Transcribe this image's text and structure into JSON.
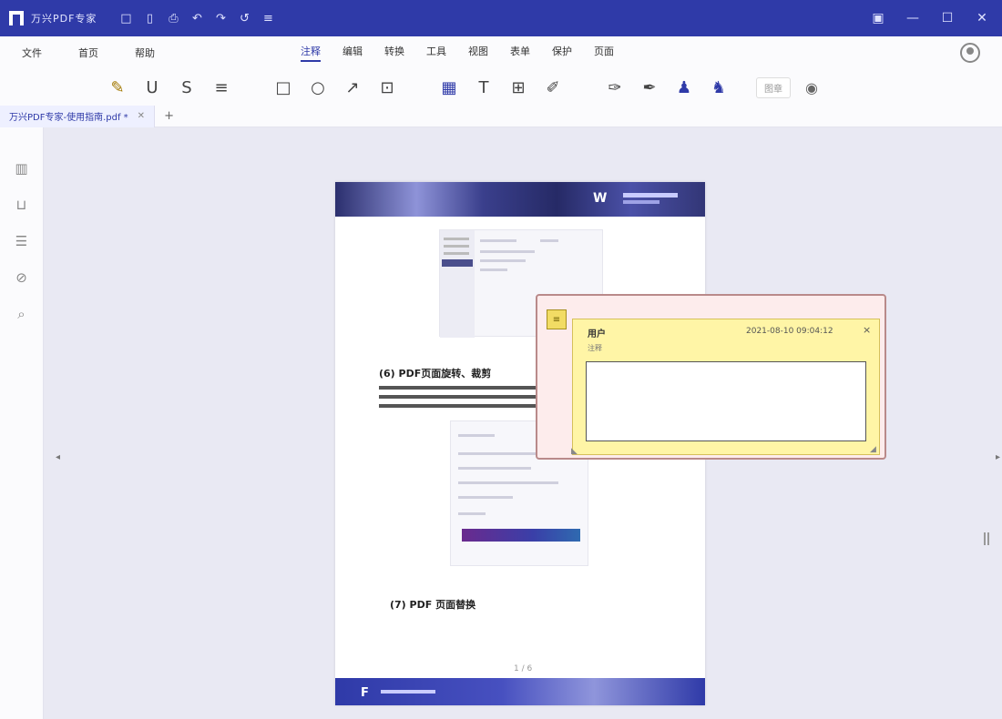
{
  "titlebar": {
    "app_title": "万兴PDF专家",
    "quick_icons": [
      "□",
      "▯",
      "⎙",
      "↶",
      "↷",
      "↺",
      "≡"
    ],
    "window_buttons": [
      "▣",
      "—",
      "☐",
      "✕"
    ]
  },
  "menubar": {
    "left": [
      "文件",
      "首页",
      "帮助"
    ],
    "right": [
      "注释",
      "编辑",
      "转换",
      "工具",
      "视图",
      "表单",
      "保护",
      "页面"
    ],
    "active": "注释"
  },
  "toolbar": {
    "stamp_label": "图章",
    "icons": [
      "highlight-icon",
      "underline-icon",
      "strikethrough-icon",
      "squiggly-icon",
      "rectangle-icon",
      "ellipse-icon",
      "arrow-icon",
      "area-icon",
      "textbox-icon",
      "typewriter-icon",
      "callout-icon",
      "pencil-icon",
      "note-icon",
      "eraser-icon",
      "attachment-icon",
      "stamp-icon",
      "signature-icon",
      "eye-icon"
    ]
  },
  "tab": {
    "label": "万兴PDF专家-使用指南.pdf *",
    "close": "✕",
    "add": "+"
  },
  "rail_icons": [
    "thumbnail-icon",
    "bookmark-icon",
    "annotation-list-icon",
    "attachment-icon",
    "search-icon"
  ],
  "page": {
    "banner_logo": "W",
    "heading_1": "(6) PDF页面旋转、裁剪",
    "heading_2": "(7) PDF 页面替换",
    "page_number": "1 / 6",
    "footer_logo": "F"
  },
  "note": {
    "anchor_icon": "note-icon",
    "author": "用户",
    "timestamp": "2021-08-10 09:04:12",
    "subtitle": "注释",
    "text": "",
    "close": "×"
  },
  "colors": {
    "brand": "#2f3aa8",
    "note_bg": "#fff5a6",
    "note_frame": "#b98a8a"
  }
}
